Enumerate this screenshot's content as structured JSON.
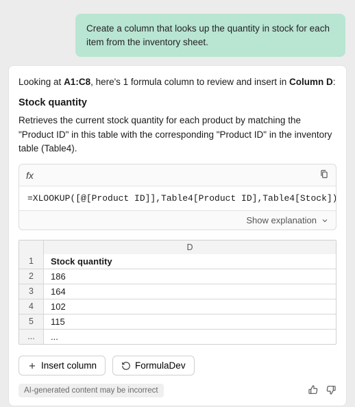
{
  "prompt": "Create a column that looks up the quantity in stock for each item from the inventory sheet.",
  "intro_prefix": "Looking at ",
  "intro_range": "A1:C8",
  "intro_mid": ", here's 1 formula column to review and insert in ",
  "intro_target": "Column D",
  "intro_suffix": ":",
  "section_title": "Stock quantity",
  "description": "Retrieves the current stock quantity for each product by matching the \"Product ID\" in this table with the corresponding \"Product ID\" in the inventory table (Table4).",
  "fx_label": "fx",
  "formula": "=XLOOKUP([@[Product ID]],Table4[Product ID],Table4[Stock])",
  "show_explanation": "Show explanation",
  "preview": {
    "column_letter": "D",
    "rows": [
      {
        "n": "1",
        "v": "Stock quantity",
        "header": true
      },
      {
        "n": "2",
        "v": "186"
      },
      {
        "n": "3",
        "v": "164"
      },
      {
        "n": "4",
        "v": "102"
      },
      {
        "n": "5",
        "v": "115"
      },
      {
        "n": "...",
        "v": "..."
      }
    ]
  },
  "buttons": {
    "insert": "Insert column",
    "formula_dev": "FormulaDev"
  },
  "disclaimer": "AI-generated content may be incorrect"
}
